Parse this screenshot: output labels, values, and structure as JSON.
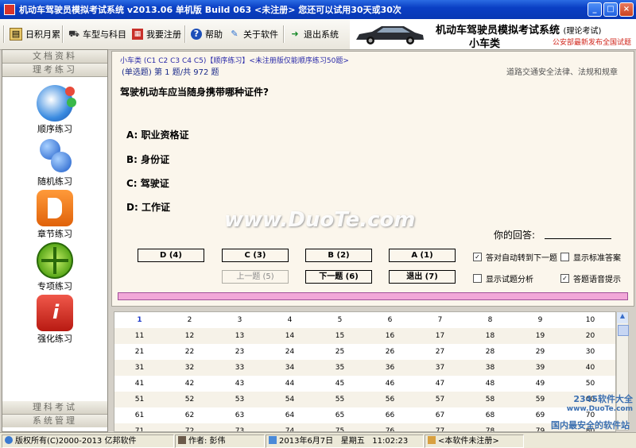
{
  "window": {
    "title": "机动车驾驶员模拟考试系统 v2013.06 单机版 Build 063 <未注册>  您还可以试用30天或30次",
    "min": "_",
    "max": "□",
    "close": "×"
  },
  "toolbar": {
    "items": [
      {
        "label": "日积月累",
        "icon": "book-icon"
      },
      {
        "label": "车型与科目",
        "icon": "car-icon"
      },
      {
        "label": "我要注册",
        "icon": "register-icon"
      },
      {
        "label": "帮助",
        "icon": "help-icon"
      },
      {
        "label": "关于软件",
        "icon": "info-icon"
      },
      {
        "label": "退出系统",
        "icon": "exit-icon"
      }
    ]
  },
  "banner": {
    "title": "机动车驾驶员模拟考试系统",
    "title_suffix": "(理论考试)",
    "sub": "小车类",
    "note": "公安部最新发布全国试题"
  },
  "sidebar": {
    "sections": [
      "文档资料",
      "理考练习"
    ],
    "tools": [
      "顺序练习",
      "随机练习",
      "章节练习",
      "专项练习",
      "强化练习"
    ],
    "footer": [
      "理科考试",
      "系统管理"
    ]
  },
  "question": {
    "breadcrumb": "小车类 (C1 C2 C3 C4 C5)【顺序练习】<未注册版仅能顺序练习50题>",
    "info": "(单选题) 第 1 题/共 972 题",
    "category": "道路交通安全法律、法规和规章",
    "text": "驾驶机动车应当随身携带哪种证件?",
    "options": [
      "A:  职业资格证",
      "B:  身份证",
      "C:  驾驶证",
      "D:  工作证"
    ],
    "answer_label": "你的回答:"
  },
  "buttons": {
    "d": "D (4)",
    "c": "C (3)",
    "b": "B (2)",
    "a": "A (1)",
    "prev": "上一题 (5)",
    "next": "下一题 (6)",
    "quit": "退出 (7)"
  },
  "checks": [
    {
      "label": "答对自动转到下一题",
      "checked": true
    },
    {
      "label": "显示标准答案",
      "checked": false
    },
    {
      "label": "显示试题分析",
      "checked": false
    },
    {
      "label": "答题语音提示",
      "checked": true
    }
  ],
  "grid": {
    "rows": [
      [
        "1",
        "2",
        "3",
        "4",
        "5",
        "6",
        "7",
        "8",
        "9",
        "10"
      ],
      [
        "11",
        "12",
        "13",
        "14",
        "15",
        "16",
        "17",
        "18",
        "19",
        "20"
      ],
      [
        "21",
        "22",
        "23",
        "24",
        "25",
        "26",
        "27",
        "28",
        "29",
        "30"
      ],
      [
        "31",
        "32",
        "33",
        "34",
        "35",
        "36",
        "37",
        "38",
        "39",
        "40"
      ],
      [
        "41",
        "42",
        "43",
        "44",
        "45",
        "46",
        "47",
        "48",
        "49",
        "50"
      ],
      [
        "51",
        "52",
        "53",
        "54",
        "55",
        "56",
        "57",
        "58",
        "59",
        "60"
      ],
      [
        "61",
        "62",
        "63",
        "64",
        "65",
        "66",
        "67",
        "68",
        "69",
        "70"
      ],
      [
        "71",
        "72",
        "73",
        "74",
        "75",
        "76",
        "77",
        "78",
        "79",
        "80"
      ]
    ],
    "current": "1"
  },
  "watermarks": {
    "duote": "www.DuoTe.com",
    "site": "2345软件大全",
    "site_url": "www.DuoTe.com",
    "slogan": "国内最安全的软件站"
  },
  "status": {
    "copyright": "版权所有(C)2000-2013 亿邦软件",
    "author": "作者: 彭伟",
    "date": "2013年6月7日",
    "weekday": "星期五",
    "time": "11:02:23",
    "reg": "<本软件未注册>"
  },
  "colors": {
    "titlebar": "#0a3fc4",
    "panel_bg": "#fbf6ec",
    "progress": "#f2a8d8",
    "current_number": "#1c39c8",
    "banner_note": "#d0241a"
  }
}
